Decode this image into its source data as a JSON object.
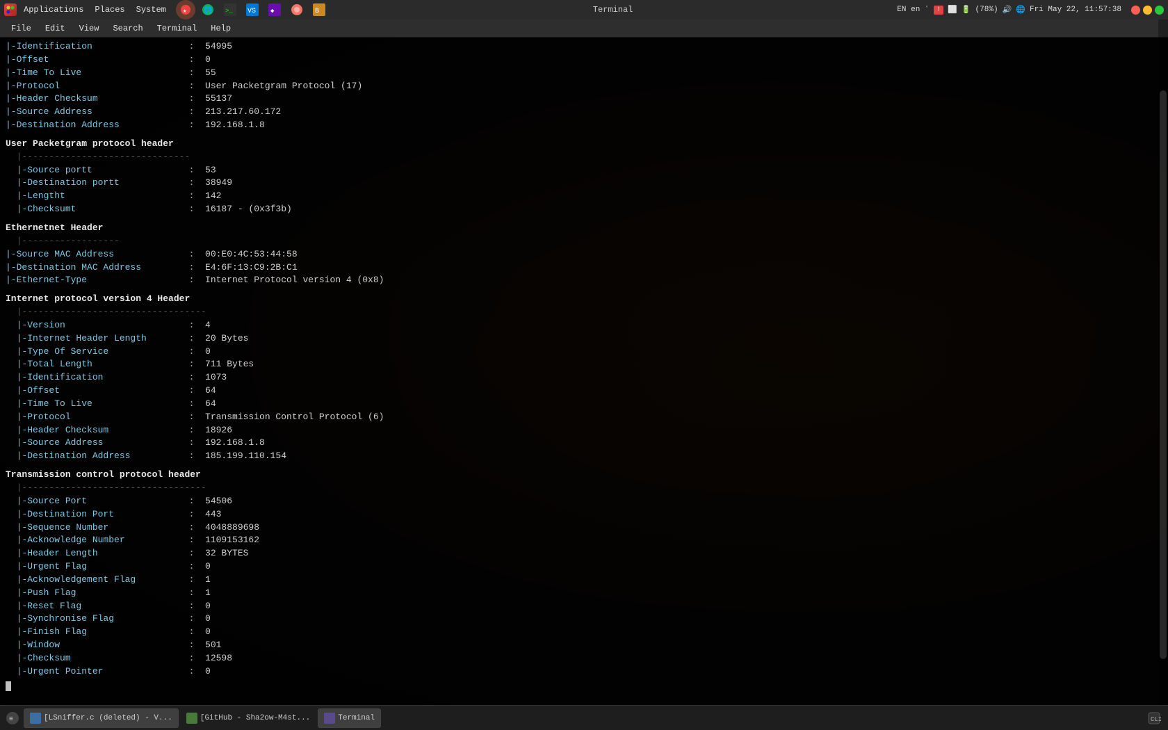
{
  "topbar": {
    "apps_label": "Applications",
    "places_label": "Places",
    "system_label": "System",
    "title": "Terminal",
    "lang": "EN en",
    "battery": "(78%)",
    "time": "Fri May 22, 11:57:38"
  },
  "menubar": {
    "items": [
      "File",
      "Edit",
      "View",
      "Search",
      "Terminal",
      "Help"
    ]
  },
  "terminal": {
    "lines": [
      {
        "label": "|-Identification",
        "sep": ":",
        "val": "54995"
      },
      {
        "label": "|-Offset",
        "sep": ":",
        "val": "0"
      },
      {
        "label": "|-Time To Live",
        "sep": ":",
        "val": "55"
      },
      {
        "label": "|-Protocol",
        "sep": ":",
        "val": "User Packetgram Protocol (17)"
      },
      {
        "label": "|-Header Checksum",
        "sep": ":",
        "val": "55137"
      },
      {
        "label": "|-Source Address",
        "sep": ":",
        "val": "213.217.60.172"
      },
      {
        "label": "|-Destination Address",
        "sep": ":",
        "val": "192.168.1.8"
      },
      {
        "label": "",
        "type": "blank"
      },
      {
        "label": "User Packetgram protocol header",
        "type": "header"
      },
      {
        "label": "  |------------------------------- ",
        "type": "separator"
      },
      {
        "label": "  |-Source portt",
        "sep": ":",
        "val": "53"
      },
      {
        "label": "  |-Destination portt",
        "sep": ":",
        "val": "38949"
      },
      {
        "label": "  |-Lengtht",
        "sep": ":",
        "val": "142"
      },
      {
        "label": "  |-Checksumt",
        "sep": ":",
        "val": "16187 - (0x3f3b)"
      },
      {
        "label": "",
        "type": "blank"
      },
      {
        "label": "Ethernetnet Header",
        "type": "header"
      },
      {
        "label": "  |------------------",
        "type": "separator"
      },
      {
        "label": "|-Source MAC Address",
        "sep": ":",
        "val": "00:E0:4C:53:44:58"
      },
      {
        "label": "|-Destination MAC Address",
        "sep": ":",
        "val": "E4:6F:13:C9:2B:C1"
      },
      {
        "label": "|-Ethernet-Type",
        "sep": ":",
        "val": "Internet Protocol version 4 (0x8)"
      },
      {
        "label": "",
        "type": "blank"
      },
      {
        "label": "Internet protocol version 4 Header",
        "type": "header"
      },
      {
        "label": "  |----------------------------------",
        "type": "separator"
      },
      {
        "label": "  |-Version",
        "sep": ":",
        "val": "4"
      },
      {
        "label": "  |-Internet Header Length",
        "sep": ":",
        "val": "20 Bytes"
      },
      {
        "label": "  |-Type Of Service",
        "sep": ":",
        "val": "0"
      },
      {
        "label": "  |-Total Length",
        "sep": ":",
        "val": "711 Bytes"
      },
      {
        "label": "  |-Identification",
        "sep": ":",
        "val": "1073"
      },
      {
        "label": "  |-Offset",
        "sep": ":",
        "val": "64"
      },
      {
        "label": "  |-Time To Live",
        "sep": ":",
        "val": "64"
      },
      {
        "label": "  |-Protocol",
        "sep": ":",
        "val": "Transmission Control Protocol (6)"
      },
      {
        "label": "  |-Header Checksum",
        "sep": ":",
        "val": "18926"
      },
      {
        "label": "  |-Source Address",
        "sep": ":",
        "val": "192.168.1.8"
      },
      {
        "label": "  |-Destination Address",
        "sep": ":",
        "val": "185.199.110.154"
      },
      {
        "label": "",
        "type": "blank"
      },
      {
        "label": "Transmission control protocol header",
        "type": "header"
      },
      {
        "label": "  |----------------------------------",
        "type": "separator"
      },
      {
        "label": "  |-Source Port",
        "sep": ":",
        "val": "54506"
      },
      {
        "label": "  |-Destination Port",
        "sep": ":",
        "val": "443"
      },
      {
        "label": "  |-Sequence Number",
        "sep": ":",
        "val": "4048889698"
      },
      {
        "label": "  |-Acknowledge Number",
        "sep": ":",
        "val": "1109153162"
      },
      {
        "label": "  |-Header Length",
        "sep": ":",
        "val": "32 BYTES"
      },
      {
        "label": "  |-Urgent Flag",
        "sep": ":",
        "val": "0"
      },
      {
        "label": "  |-Acknowledgement Flag",
        "sep": ":",
        "val": "1"
      },
      {
        "label": "  |-Push Flag",
        "sep": ":",
        "val": "1"
      },
      {
        "label": "  |-Reset Flag",
        "sep": ":",
        "val": "0"
      },
      {
        "label": "  |-Synchronise Flag",
        "sep": ":",
        "val": "0"
      },
      {
        "label": "  |-Finish Flag",
        "sep": ":",
        "val": "0"
      },
      {
        "label": "  |-Window",
        "sep": ":",
        "val": "501"
      },
      {
        "label": "  |-Checksum",
        "sep": ":",
        "val": "12598"
      },
      {
        "label": "  |-Urgent Pointer",
        "sep": ":",
        "val": "0"
      }
    ]
  },
  "taskbar": {
    "items": [
      {
        "label": "[LSniffer.c (deleted) - V...",
        "color": "#3a6ea5"
      },
      {
        "label": "[GitHub - Sha2ow-M4st...",
        "color": "#4a7a3a"
      },
      {
        "label": "Terminal",
        "color": "#5a4a8a",
        "active": true
      }
    ]
  }
}
